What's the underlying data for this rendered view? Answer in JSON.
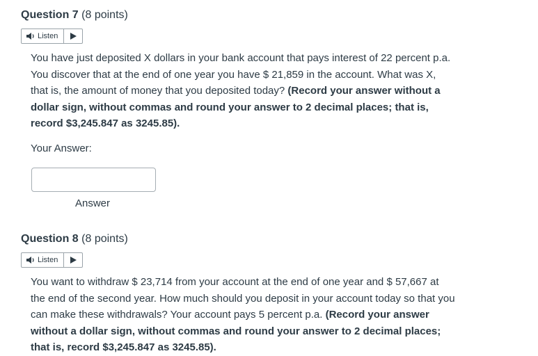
{
  "listen_label": "Listen",
  "q7": {
    "number": "Question 7",
    "points": "(8 points)",
    "text": "You have just deposited X dollars in your bank account that pays interest of 22 percent p.a. You discover that at the end of one year you have $ 21,859 in the account. What was X, that is, the amount of money that you deposited today?",
    "instruction": "(Record your answer without a dollar sign, without commas and round your answer to 2 decimal places; that is, record $3,245.847 as 3245.85).",
    "your_answer_label": "Your Answer:",
    "answer_value": "",
    "answer_label": "Answer"
  },
  "q8": {
    "number": "Question 8",
    "points": "(8 points)",
    "text": "You want to withdraw $ 23,714 from your account at the end of one year and $ 57,667 at the end of the second year. How much should you deposit in your account today so that you can make these withdrawals? Your account pays 5 percent p.a.",
    "instruction": "(Record your answer without a dollar sign, without commas and round your answer to 2 decimal places; that is, record $3,245.847 as 3245.85)."
  }
}
